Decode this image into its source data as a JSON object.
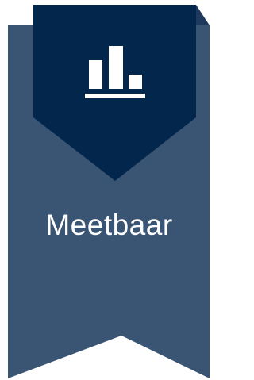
{
  "badge": {
    "label": "Meetbaar",
    "icon": "bar-chart-icon",
    "colors": {
      "ribbon": "#3A5573",
      "flag": "#03264C",
      "flag_fold": "#1F3A5C",
      "icon": "#FFFFFF",
      "label": "#FFFFFF"
    }
  }
}
